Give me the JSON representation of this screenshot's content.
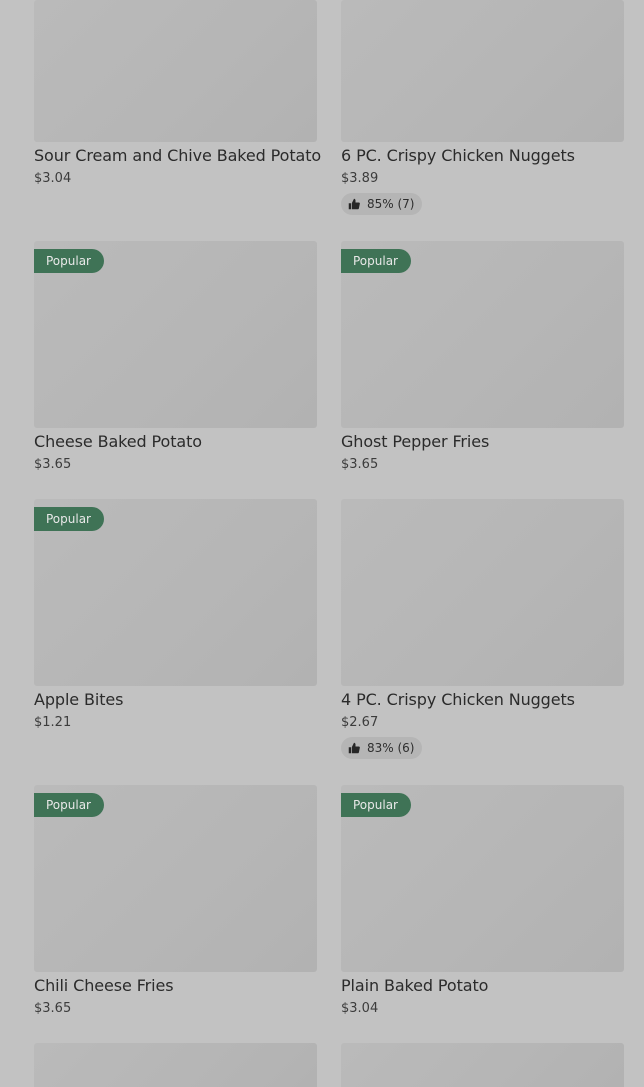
{
  "items": [
    {
      "name": "Sour Cream and Chive Baked Potato",
      "price": "$3.04"
    },
    {
      "name": "6 PC. Crispy Chicken Nuggets",
      "price": "$3.89",
      "rating": "85% (7)"
    },
    {
      "name": "Cheese Baked Potato",
      "price": "$3.65",
      "badge": "Popular"
    },
    {
      "name": "Ghost Pepper Fries",
      "price": "$3.65",
      "badge": "Popular"
    },
    {
      "name": "Apple Bites",
      "price": "$1.21",
      "badge": "Popular"
    },
    {
      "name": "4 PC. Crispy Chicken Nuggets",
      "price": "$2.67",
      "rating": "83% (6)"
    },
    {
      "name": "Chili Cheese Fries",
      "price": "$3.65",
      "badge": "Popular"
    },
    {
      "name": "Plain Baked Potato",
      "price": "$3.04",
      "badge": "Popular"
    }
  ]
}
